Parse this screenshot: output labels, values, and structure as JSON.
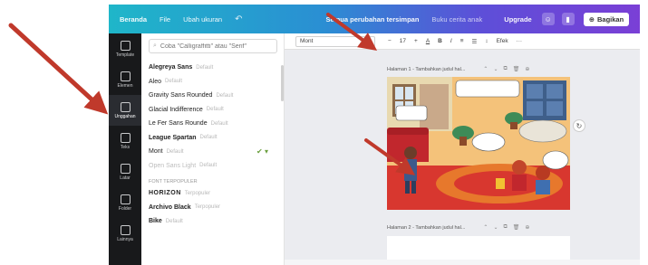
{
  "topbar": {
    "home_label": "Beranda",
    "file_label": "File",
    "resize_label": "Ubah ukuran",
    "undo_icon": "undo-icon",
    "status_label": "Semua perubahan tersimpan",
    "doc_title": "Buku cerita anak",
    "upgrade_label": "Upgrade",
    "share_label": "Bagikan"
  },
  "rail": {
    "items": [
      {
        "label": "Template",
        "icon": "template-icon"
      },
      {
        "label": "Elemen",
        "icon": "elements-icon"
      },
      {
        "label": "Unggahan",
        "icon": "uploads-icon"
      },
      {
        "label": "Teks",
        "icon": "text-icon"
      },
      {
        "label": "Latar",
        "icon": "background-icon"
      },
      {
        "label": "Folder",
        "icon": "folder-icon"
      },
      {
        "label": "Lainnya",
        "icon": "more-icon"
      }
    ]
  },
  "panel": {
    "search_placeholder": "Coba \"Calligraffitti\" atau \"Serif\"",
    "fonts": [
      {
        "name": "Alegreya Sans",
        "desc": "Default",
        "style": "bold"
      },
      {
        "name": "Aleo",
        "desc": "Default",
        "style": "normal"
      },
      {
        "name": "Gravity Sans Rounded",
        "desc": "Default",
        "style": "normal"
      },
      {
        "name": "Glacial Indifference",
        "desc": "Default",
        "style": "normal"
      },
      {
        "name": "Le Fer Sans Rounde",
        "desc": "Default",
        "style": "normal"
      },
      {
        "name": "League Spartan",
        "desc": "Default",
        "style": "bold"
      },
      {
        "name": "Mont",
        "desc": "Default",
        "style": "normal",
        "checked": true
      },
      {
        "name": "Open Sans Light",
        "desc": "Default",
        "style": "light"
      }
    ],
    "section_label": "FONT TERPOPULER",
    "popular_fonts": [
      {
        "name": "HORIZON",
        "desc": "Terpopuler",
        "style": "bold"
      },
      {
        "name": "Archivo Black",
        "desc": "Terpopuler",
        "style": "bold"
      },
      {
        "name": "Bike",
        "desc": "Default",
        "style": "bold"
      }
    ]
  },
  "toolbar": {
    "font_value": "Mont",
    "size_value": "17",
    "minus": "−",
    "plus": "+",
    "text_color": "A",
    "bold": "B",
    "italic": "I",
    "underline": "U",
    "align": "≡",
    "list": "☰",
    "spacing": "↕",
    "effects": "Efek",
    "more": "···"
  },
  "pages": [
    {
      "header": "Halaman 1 - Tambahkan judul hal...",
      "icons": [
        "chevron-up-icon",
        "chevron-down-icon",
        "copy-icon",
        "delete-icon",
        "add-icon"
      ]
    },
    {
      "header": "Halaman 2 - Tambahkan judul hal...",
      "icons": [
        "chevron-up-icon",
        "chevron-down-icon",
        "copy-icon",
        "delete-icon",
        "add-icon"
      ]
    }
  ],
  "colors": {
    "topbar_start": "#1fb6c9",
    "topbar_end": "#7a3fd6",
    "rail_bg": "#18191b",
    "editor_bg": "#ebecf0",
    "arrow": "#c0392b"
  }
}
